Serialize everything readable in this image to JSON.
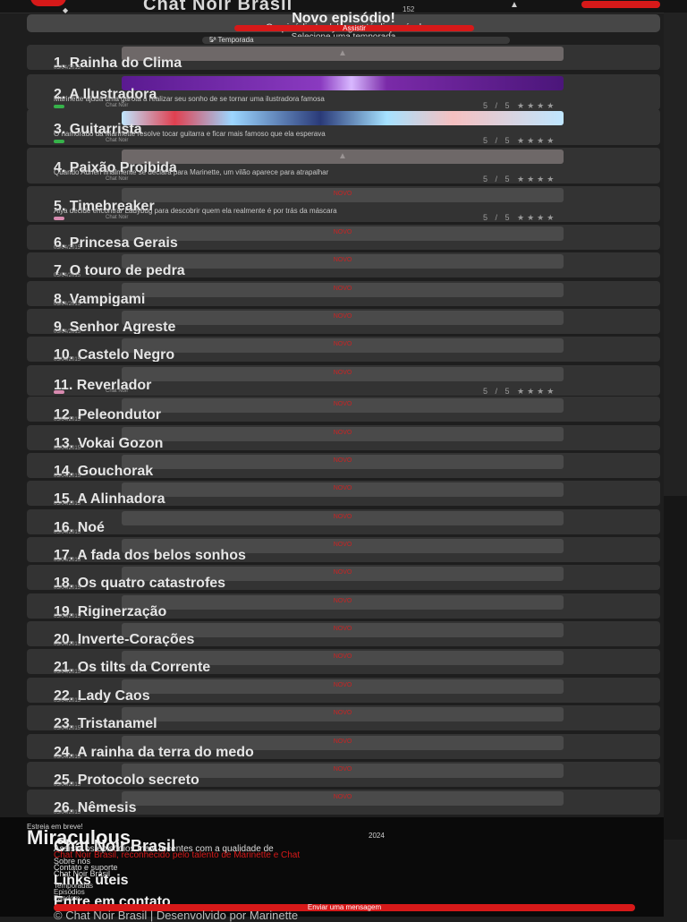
{
  "header": {
    "brand": "Chat Noir Brasil",
    "nav_number": "152"
  },
  "banner": {
    "title": "Novo episódio!",
    "subtitle": "O episódio Ladybug está disponível",
    "watch_label": "Assistir"
  },
  "season": {
    "label": "Selecione uma temporada",
    "selected": "5ª Temporada"
  },
  "episodes": [
    {
      "num": "1.",
      "title": "Rainha do Clima",
      "date": "05/04/2015",
      "thumb": "arrow"
    },
    {
      "num": "2.",
      "title": "A Ilustradora",
      "date": "",
      "thumb": "purple",
      "desc": "Marinette ajuda uma garota a realizar seu sonho de se tornar uma ilustradora famosa",
      "meta": "Chat Noir",
      "rating": "5 / 5 ★★★★",
      "dot": "green"
    },
    {
      "num": "3.",
      "title": "Guitarrista",
      "date": "",
      "thumb": "blue",
      "desc": "O namorado da Marinette resolve tocar guitarra e ficar mais famoso que ela esperava",
      "meta": "Chat Noir",
      "rating": "5 / 5 ★★★★",
      "dot": "green"
    },
    {
      "num": "4.",
      "title": "Paixão Proibida",
      "date": "",
      "thumb": "arrow",
      "desc": "Quando Adrien finalmente se declara para Marinette, um vilão aparece para atrapalhar",
      "meta": "Chat Noir",
      "rating": "5 / 5 ★★★★"
    },
    {
      "num": "5.",
      "title": "Timebreaker",
      "date": "",
      "thumb": "tag",
      "desc": "Alya decide encontrar Ladybug para descobrir quem ela realmente é por trás da máscara",
      "meta": "Chat Noir",
      "rating": "5 / 5 ★★★★",
      "dot": "pink"
    },
    {
      "num": "6.",
      "title": "Princesa Gerais",
      "date": "05/04/2015",
      "thumb": "tag"
    },
    {
      "num": "7.",
      "title": "O touro de pedra",
      "date": "05/04/2015",
      "thumb": "tag"
    },
    {
      "num": "8.",
      "title": "Vampigami",
      "date": "05/04/2015",
      "thumb": "tag"
    },
    {
      "num": "9.",
      "title": "Senhor Agreste",
      "date": "05/04/2015",
      "thumb": "tag"
    },
    {
      "num": "10.",
      "title": "Castelo Negro",
      "date": "05/04/2015",
      "thumb": "tag"
    },
    {
      "num": "11.",
      "title": "Reverlador",
      "date": "",
      "thumb": "tag",
      "meta": "Chat Noir",
      "rating": "5 / 5 ★★★★",
      "dot": "pink"
    },
    {
      "num": "12.",
      "title": "Peleondutor",
      "date": "05/04/2015",
      "thumb": "tag"
    },
    {
      "num": "13.",
      "title": "Vokai Gozon",
      "date": "05/04/2015",
      "thumb": "tag"
    },
    {
      "num": "14.",
      "title": "Gouchorak",
      "date": "05/04/2015",
      "thumb": "tag"
    },
    {
      "num": "15.",
      "title": "A Alinhadora",
      "date": "05/04/2015",
      "thumb": "tag"
    },
    {
      "num": "16.",
      "title": "Noé",
      "date": "05/04/2015",
      "thumb": "tag"
    },
    {
      "num": "17.",
      "title": "A fada dos belos sonhos",
      "date": "05/04/2015",
      "thumb": "tag"
    },
    {
      "num": "18.",
      "title": "Os quatro catastrofes",
      "date": "05/04/2015",
      "thumb": "tag"
    },
    {
      "num": "19.",
      "title": "Riginerzação",
      "date": "05/04/2015",
      "thumb": "tag"
    },
    {
      "num": "20.",
      "title": "Inverte-Corações",
      "date": "05/04/2015",
      "thumb": "tag"
    },
    {
      "num": "21.",
      "title": "Os tilts da Corrente",
      "date": "05/04/2015",
      "thumb": "tag"
    },
    {
      "num": "22.",
      "title": "Lady Caos",
      "date": "05/04/2015",
      "thumb": "tag"
    },
    {
      "num": "23.",
      "title": "Tristanamel",
      "date": "05/04/2015",
      "thumb": "tag"
    },
    {
      "num": "24.",
      "title": "A rainha da terra do medo",
      "date": "05/04/2015",
      "thumb": "tag"
    },
    {
      "num": "25.",
      "title": "Protocolo secreto",
      "date": "05/04/2015",
      "thumb": "tag"
    },
    {
      "num": "26.",
      "title": "Nêmesis",
      "date": "05/04/2015",
      "thumb": "tag"
    }
  ],
  "thumb_tag_text": "NOVO",
  "footer": {
    "watching": "Estreia em breve!",
    "series": "Miraculous",
    "year": "2024",
    "series2": "Chat Noir Brasil",
    "desc1": "Assista os episódios mais recentes com a qualidade de",
    "desc2": "Chat Noir Brasil, reconhecido pelo talento de Marinette e Chat",
    "links": [
      "Sobre nós",
      "Contato e suporte",
      "Chat Noir Brasil"
    ],
    "follow_title": "Links úteis",
    "follow_items": [
      "Temporadas",
      "Episódios",
      "Fandom"
    ],
    "contact_title": "Entre em contato",
    "contact_button": "Enviar uma mensagem",
    "copyright": "© Chat Noir Brasil | Desenvolvido por Marinette"
  }
}
